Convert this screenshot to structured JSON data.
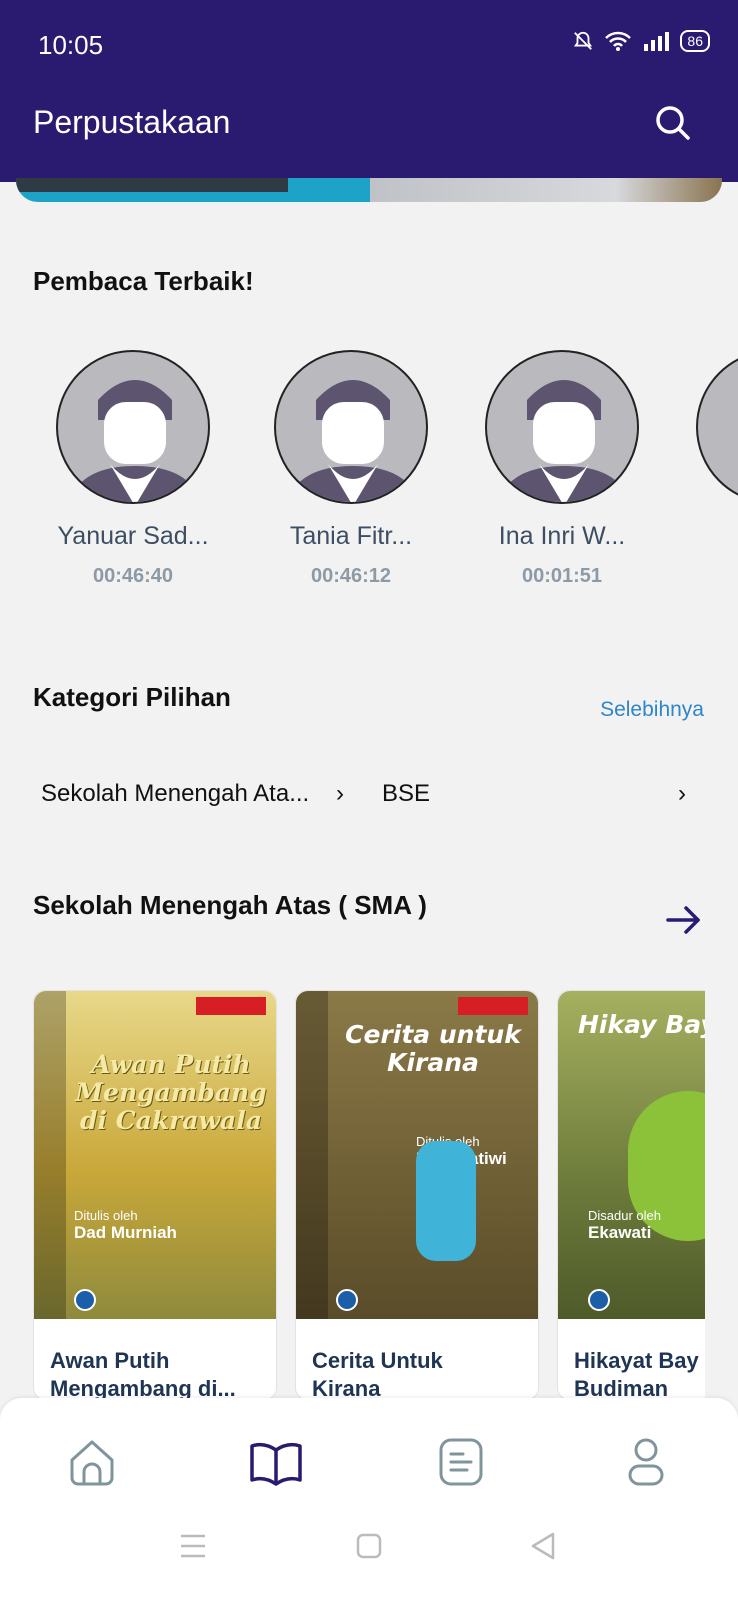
{
  "status_bar": {
    "time": "10:05",
    "battery": "86"
  },
  "app_bar": {
    "title": "Perpustakaan"
  },
  "top_readers": {
    "heading": "Pembaca Terbaik!",
    "readers": [
      {
        "name": "Yanuar Sad...",
        "time": "00:46:40"
      },
      {
        "name": "Tania Fitr...",
        "time": "00:46:12"
      },
      {
        "name": "Ina Inri W...",
        "time": "00:01:51"
      }
    ]
  },
  "categories": {
    "heading": "Kategori Pilihan",
    "more_label": "Selebihnya",
    "items": [
      "Sekolah Menengah Ata...",
      "BSE"
    ]
  },
  "sma_section": {
    "heading": "Sekolah Menengah Atas ( SMA )",
    "books": [
      {
        "title_line1": "Awan Putih",
        "title_line2": "Mengambang di...",
        "cover_title": "Awan Putih Mengambang di Cakrawala",
        "cover_author_prefix": "Ditulis oleh",
        "cover_author": "Dad Murniah",
        "cover_color": "#c9a83a"
      },
      {
        "title_line1": "Cerita Untuk",
        "title_line2": "Kirana",
        "cover_title": "Cerita untuk Kirana",
        "cover_author_prefix": "Ditulis oleh",
        "cover_author": "Dwi Pratiwi",
        "cover_color": "#7a6a3e"
      },
      {
        "title_line1": "Hikayat Bay",
        "title_line2": "Budiman",
        "cover_title": "Hikay Bayan Bi",
        "cover_author_prefix": "Disadur oleh",
        "cover_author": "Ekawati",
        "cover_color": "#6b7a3a"
      }
    ]
  },
  "nav": {
    "items": [
      "home-icon",
      "book-icon",
      "document-icon",
      "profile-icon"
    ],
    "active_index": 1
  },
  "colors": {
    "primary": "#2a1a70",
    "link": "#2e86c9",
    "nav_inactive": "#7f949b"
  }
}
